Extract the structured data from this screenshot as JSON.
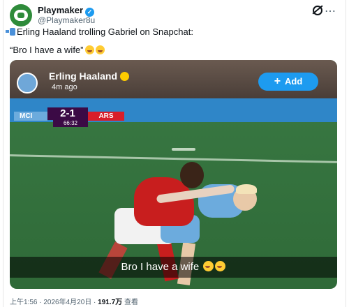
{
  "post": {
    "author_name": "Playmaker",
    "author_handle": "@Playmaker8u",
    "text_line1": "Erling Haaland trolling Gabriel on Snapchat:",
    "text_line2": "“Bro I have a wife”",
    "icons": {
      "verified": "verified-badge-icon",
      "grok": "grok-icon",
      "more": "more-icon",
      "phone": "mobile-phone-icon"
    }
  },
  "media": {
    "snap_name": "Erling Haaland",
    "snap_time": "4m ago",
    "add_label": "Add",
    "score": {
      "home": "MCI",
      "score": "2-1",
      "away": "ARS",
      "clock": "66:32"
    },
    "caption": "Bro I have a wife"
  },
  "footer": {
    "time_date": "上午1:56 · 2026年4月20日 · ",
    "views": "191.7万",
    "views_suffix": " 查看"
  },
  "colors": {
    "accent": "#1d9bf0",
    "man_city": "#6cabdd",
    "arsenal": "#d81e2a"
  }
}
